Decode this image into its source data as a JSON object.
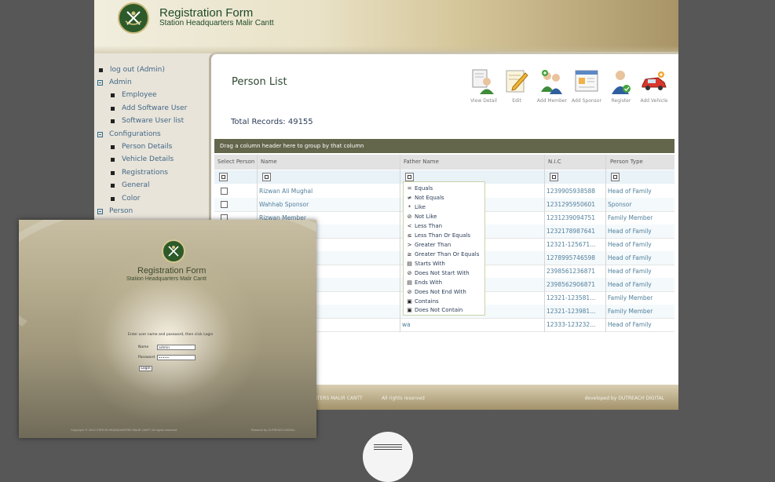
{
  "banner": {
    "title": "Registration Form",
    "subtitle": "Station Headquarters Malir Cantt"
  },
  "sidebar": {
    "items": [
      {
        "label": "log out (Admin)",
        "kind": "bullet"
      },
      {
        "label": "Admin",
        "kind": "toggle"
      },
      {
        "label": "Employee",
        "kind": "bullet"
      },
      {
        "label": "Add Software User",
        "kind": "bullet"
      },
      {
        "label": "Software User list",
        "kind": "bullet"
      },
      {
        "label": "Configurations",
        "kind": "toggle"
      },
      {
        "label": "Person Details",
        "kind": "bullet"
      },
      {
        "label": "Vehicle Details",
        "kind": "bullet"
      },
      {
        "label": "Registrations",
        "kind": "bullet"
      },
      {
        "label": "General",
        "kind": "bullet"
      },
      {
        "label": "Color",
        "kind": "bullet"
      },
      {
        "label": "Person",
        "kind": "toggle"
      }
    ]
  },
  "page": {
    "title": "Person List",
    "total_records": "Total Records: 49155"
  },
  "toolbar": [
    {
      "label": "View Detail",
      "icon": "person-document-icon"
    },
    {
      "label": "Edit",
      "icon": "edit-pencil-icon"
    },
    {
      "label": "Add Member",
      "icon": "add-member-icon"
    },
    {
      "label": "Add Sponsor",
      "icon": "add-sponsor-icon"
    },
    {
      "label": "Register",
      "icon": "register-person-icon"
    },
    {
      "label": "Add Vehicle",
      "icon": "add-vehicle-icon"
    }
  ],
  "grid": {
    "group_hint": "Drag a column header here to group by that column",
    "columns": [
      "Select Person",
      "Name",
      "Father Name",
      "N.I.C",
      "Person Type"
    ],
    "rows": [
      {
        "name": "Rizwan Ali Mughal",
        "father": "",
        "nic": "1239905938588",
        "type": "Head of Family"
      },
      {
        "name": "Wahhab Sponsor",
        "father": "",
        "nic": "1231295950601",
        "type": "Sponsor"
      },
      {
        "name": "Rizwan Member",
        "father": "",
        "nic": "1231239094751",
        "type": "Family Member"
      },
      {
        "name": "",
        "father": "",
        "nic": "1232178987641",
        "type": "Head of Family"
      },
      {
        "name": "",
        "father": "",
        "nic": "12321-125671...",
        "type": "Head of Family"
      },
      {
        "name": "",
        "father": "",
        "nic": "1278995746598",
        "type": "Head of Family"
      },
      {
        "name": "",
        "father": "",
        "nic": "2398561236871",
        "type": "Head of Family"
      },
      {
        "name": "",
        "father": "",
        "nic": "2398562906871",
        "type": "Head of Family"
      },
      {
        "name": "",
        "father": "",
        "nic": "12321-123581...",
        "type": "Family Member"
      },
      {
        "name": "",
        "father": "",
        "nic": "12321-123981...",
        "type": "Family Member"
      },
      {
        "name": "",
        "father": "wa",
        "nic": "12333-123232...",
        "type": "Head of Family"
      }
    ]
  },
  "filter_menu": [
    {
      "icon": "=",
      "label": "Equals"
    },
    {
      "icon": "≠",
      "label": "Not Equals"
    },
    {
      "icon": "*",
      "label": "Like"
    },
    {
      "icon": "⊘",
      "label": "Not Like"
    },
    {
      "icon": "<",
      "label": "Less Than"
    },
    {
      "icon": "≤",
      "label": "Less Than Or Equals"
    },
    {
      "icon": ">",
      "label": "Greater Than"
    },
    {
      "icon": "≥",
      "label": "Greater Than Or Equals"
    },
    {
      "icon": "▤",
      "label": "Starts With"
    },
    {
      "icon": "⊘",
      "label": "Does Not Start With"
    },
    {
      "icon": "▤",
      "label": "Ends With"
    },
    {
      "icon": "⊘",
      "label": "Does Not End With"
    },
    {
      "icon": "▣",
      "label": "Contains"
    },
    {
      "icon": "▣",
      "label": "Does Not Contain"
    }
  ],
  "footer": {
    "left": "ARTERS MALIR CANTT",
    "rights": "All rights reserved",
    "developer": "developed by  OUTREACH DIGITAL"
  },
  "login": {
    "title": "Registration Form",
    "subtitle": "Station Headquarters Malir Cantt",
    "instructions": "Enter user name and password, then click Login",
    "name_label": "Name",
    "name_value": "admin",
    "password_label": "Password",
    "password_value": "•••••",
    "button": "Login",
    "copyright": "Copyright © 2010   STATION HEADQUARTERS MALIR CANTT   All rights reserved",
    "powered": "Powered by  OUTREACH DIGITAL"
  },
  "colors": {
    "brand_green": "#2d5a2a",
    "link_blue": "#51809b",
    "group_bar": "#64664c"
  }
}
